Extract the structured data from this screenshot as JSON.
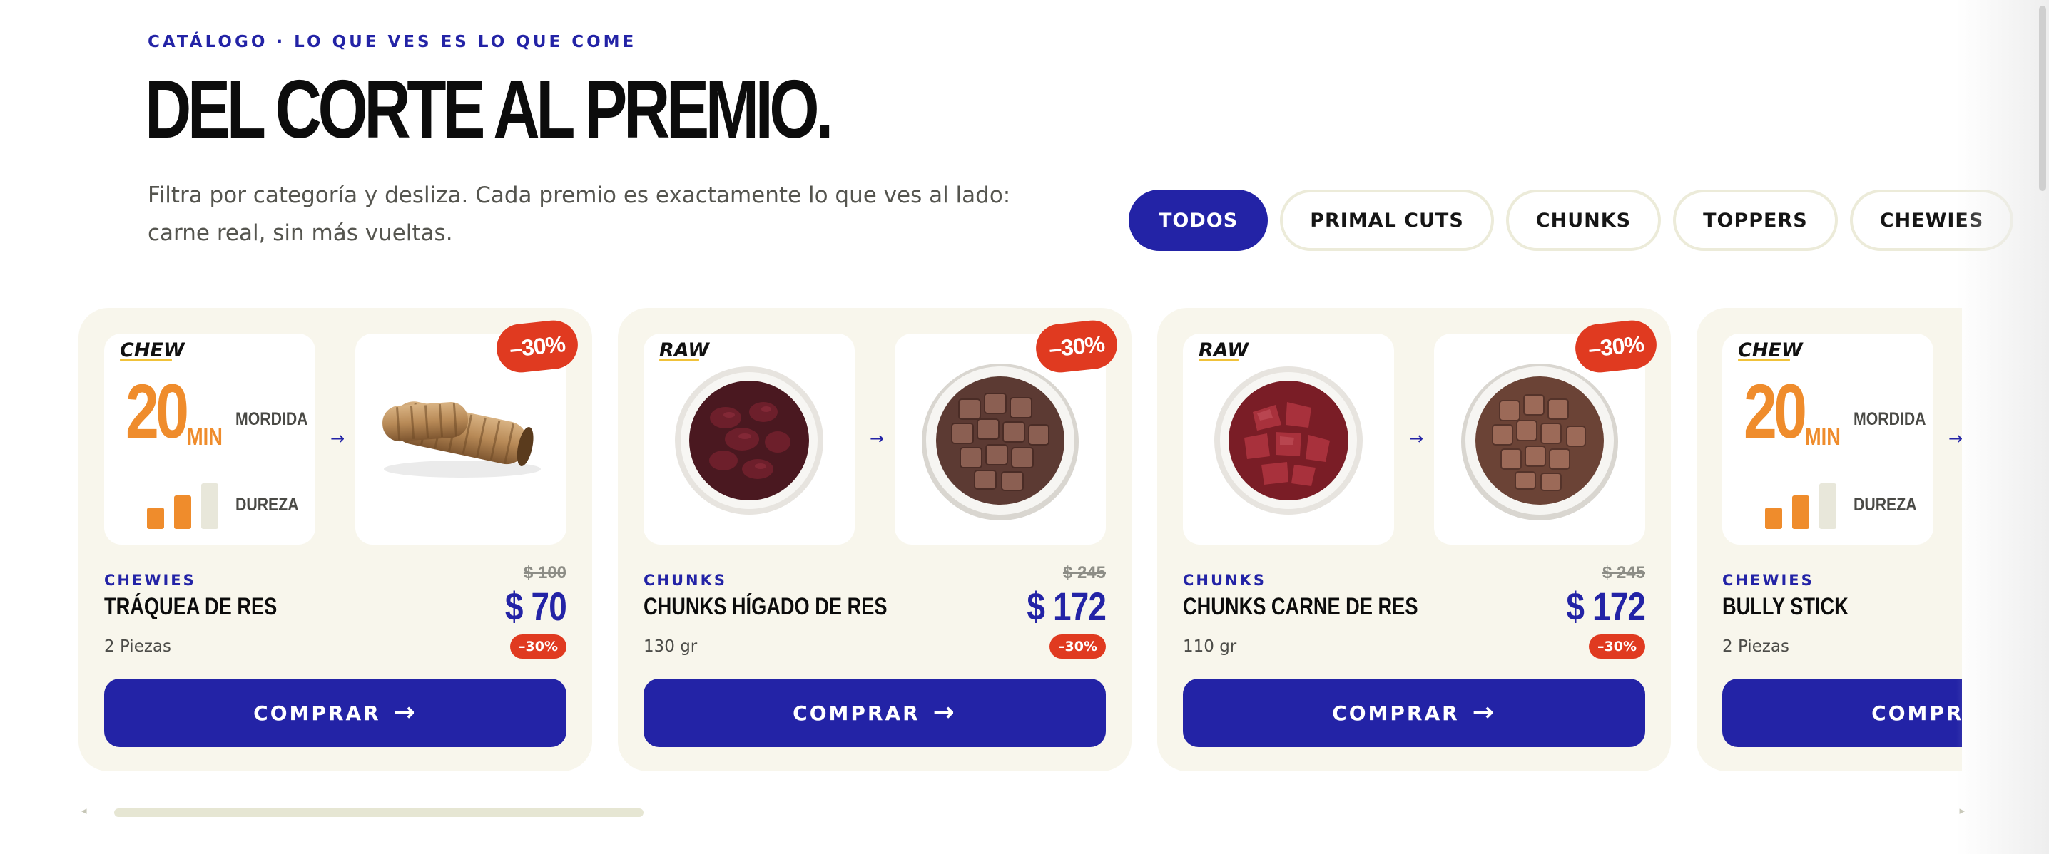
{
  "header": {
    "eyebrow": "CATÁLOGO · LO QUE VES ES LO QUE COME",
    "title": "DEL CORTE AL PREMIO.",
    "intro": "Filtra por categoría y desliza. Cada premio es exactamente lo que ves al lado: carne real, sin más vueltas."
  },
  "filters": [
    {
      "label": "TODOS",
      "active": true
    },
    {
      "label": "PRIMAL CUTS",
      "active": false
    },
    {
      "label": "CHUNKS",
      "active": false
    },
    {
      "label": "TOPPERS",
      "active": false
    },
    {
      "label": "CHEWIES",
      "active": false
    }
  ],
  "colors": {
    "brand": "#2323a6",
    "discount": "#e03a20",
    "accent_orange": "#ef8c2c",
    "card_bg": "#f8f6ec"
  },
  "products": [
    {
      "tag": "CHEW",
      "stat_value": "20",
      "stat_unit": "MIN",
      "stat_label_1": "MORDIDA",
      "stat_label_2": "DUREZA",
      "hardness_level": 2,
      "hardness_max": 3,
      "discount_badge": "–30%",
      "category": "CHEWIES",
      "name": "TRÁQUEA DE RES",
      "quantity": "2 Piezas",
      "old_price": "$ 100",
      "price": "$ 70",
      "discount_pill": "–30%",
      "button": "COMPRAR",
      "image": "trachea-icon"
    },
    {
      "tag": "RAW",
      "discount_badge": "–30%",
      "category": "CHUNKS",
      "name": "CHUNKS HÍGADO DE RES",
      "quantity": "130 gr",
      "old_price": "$ 245",
      "price": "$ 172",
      "discount_pill": "–30%",
      "button": "COMPRAR",
      "image": "liver-chunks-icon"
    },
    {
      "tag": "RAW",
      "discount_badge": "–30%",
      "category": "CHUNKS",
      "name": "CHUNKS CARNE DE RES",
      "quantity": "110 gr",
      "old_price": "$ 245",
      "price": "$ 172",
      "discount_pill": "–30%",
      "button": "COMPRAR",
      "image": "beef-chunks-icon"
    },
    {
      "tag": "CHEW",
      "stat_value": "20",
      "stat_unit": "MIN",
      "stat_label_1": "MORDIDA",
      "stat_label_2": "DUREZA",
      "hardness_level": 2,
      "hardness_max": 3,
      "category": "CHEWIES",
      "name": "BULLY STICK",
      "quantity": "2 Piezas",
      "button": "COMPRAR"
    }
  ],
  "icons": {
    "flow_arrow": "→",
    "button_arrow": "→",
    "scroll_left": "◂",
    "scroll_right": "▸"
  }
}
